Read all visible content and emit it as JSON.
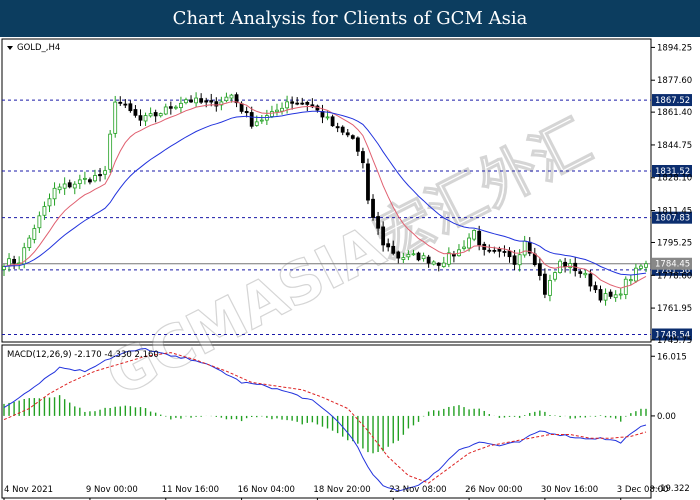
{
  "header": {
    "title": "Chart Analysis for Clients of GCM Asia"
  },
  "watermark": {
    "text": "GCMASIA宏汇外汇"
  },
  "chart_data": [
    {
      "type": "candlestick",
      "symbol_label": "GOLD_,H4",
      "ylim": [
        1745.75,
        1897.5
      ],
      "y_ticks": [
        "1894.25",
        "1877.60",
        "1861.40",
        "1844.75",
        "1828.10",
        "1811.45",
        "1795.25",
        "1778.60",
        "1761.95",
        "1745.75"
      ],
      "x_labels": [
        {
          "label": "4 Nov 2021",
          "index": 0
        },
        {
          "label": "9 Nov 00:00",
          "index": 17
        },
        {
          "label": "11 Nov 16:00",
          "index": 32
        },
        {
          "label": "16 Nov 04:00",
          "index": 47
        },
        {
          "label": "18 Nov 20:00",
          "index": 62
        },
        {
          "label": "23 Nov 08:00",
          "index": 77
        },
        {
          "label": "26 Nov 00:00",
          "index": 92
        },
        {
          "label": "30 Nov 16:00",
          "index": 107
        },
        {
          "label": "3 Dec 08:00",
          "index": 122
        }
      ],
      "levels": [
        {
          "label": "1867.52",
          "value": 1867.52
        },
        {
          "label": "1831.52",
          "value": 1831.52
        },
        {
          "label": "1807.83",
          "value": 1807.83
        },
        {
          "label": "1781.36",
          "value": 1781.36
        },
        {
          "label": "1748.54",
          "value": 1748.54
        }
      ],
      "current_price": {
        "label": "1784.45",
        "value": 1784.45
      },
      "ma_fast_color": "#e06070",
      "ma_slow_color": "#2233dd",
      "up_color": "#22a022",
      "down_color": "#000000",
      "close_anchors": [
        [
          0,
          1785
        ],
        [
          3,
          1786
        ],
        [
          6,
          1803
        ],
        [
          10,
          1822
        ],
        [
          16,
          1827
        ],
        [
          20,
          1830
        ],
        [
          22,
          1868
        ],
        [
          27,
          1857
        ],
        [
          30,
          1860
        ],
        [
          36,
          1868
        ],
        [
          41,
          1865
        ],
        [
          45,
          1870
        ],
        [
          49,
          1856
        ],
        [
          53,
          1860
        ],
        [
          56,
          1867
        ],
        [
          60,
          1866
        ],
        [
          63,
          1860
        ],
        [
          66,
          1852
        ],
        [
          69,
          1848
        ],
        [
          71,
          1835
        ],
        [
          72,
          1815
        ],
        [
          75,
          1795
        ],
        [
          78,
          1788
        ],
        [
          82,
          1788
        ],
        [
          86,
          1785
        ],
        [
          90,
          1791
        ],
        [
          93,
          1801
        ],
        [
          95,
          1790
        ],
        [
          99,
          1789
        ],
        [
          101,
          1785
        ],
        [
          103,
          1797
        ],
        [
          105,
          1786
        ],
        [
          107,
          1770
        ],
        [
          110,
          1785
        ],
        [
          113,
          1782
        ],
        [
          115,
          1778
        ],
        [
          118,
          1768
        ],
        [
          121,
          1767
        ],
        [
          123,
          1775
        ],
        [
          126,
          1783
        ],
        [
          127,
          1784.45
        ]
      ]
    },
    {
      "type": "macd",
      "label": "MACD(12,26,9) -2.170 -4.330 2.160",
      "ylim": [
        -21.5,
        18.5
      ],
      "y_ticks": [
        "16.015",
        "0.00",
        "-19.322"
      ],
      "series": [
        {
          "name": "MACD",
          "color": "#2233dd",
          "anchors": [
            [
              0,
              2
            ],
            [
              4,
              6
            ],
            [
              8,
              10
            ],
            [
              11,
              13
            ],
            [
              16,
              12
            ],
            [
              20,
              15
            ],
            [
              24,
              17
            ],
            [
              28,
              18
            ],
            [
              33,
              16
            ],
            [
              38,
              15
            ],
            [
              43,
              12
            ],
            [
              47,
              9
            ],
            [
              52,
              8
            ],
            [
              57,
              6
            ],
            [
              61,
              4
            ],
            [
              65,
              0
            ],
            [
              69,
              -6
            ],
            [
              72,
              -14
            ],
            [
              75,
              -19
            ],
            [
              78,
              -20
            ],
            [
              81,
              -19
            ],
            [
              84,
              -17
            ],
            [
              87,
              -13
            ],
            [
              90,
              -9
            ],
            [
              94,
              -7
            ],
            [
              98,
              -8
            ],
            [
              102,
              -7
            ],
            [
              106,
              -4
            ],
            [
              110,
              -5
            ],
            [
              114,
              -6
            ],
            [
              118,
              -6
            ],
            [
              122,
              -7
            ],
            [
              125,
              -4
            ],
            [
              127,
              -2.17
            ]
          ]
        },
        {
          "name": "Signal",
          "color": "#dd2222",
          "dashed": true,
          "anchors": [
            [
              0,
              -1
            ],
            [
              5,
              2
            ],
            [
              9,
              6
            ],
            [
              13,
              9
            ],
            [
              18,
              12
            ],
            [
              23,
              14
            ],
            [
              28,
              16
            ],
            [
              33,
              17
            ],
            [
              38,
              15
            ],
            [
              44,
              12
            ],
            [
              49,
              9
            ],
            [
              54,
              8
            ],
            [
              59,
              7
            ],
            [
              63,
              5
            ],
            [
              68,
              2
            ],
            [
              72,
              -4
            ],
            [
              76,
              -11
            ],
            [
              80,
              -16
            ],
            [
              84,
              -18
            ],
            [
              88,
              -14
            ],
            [
              92,
              -10
            ],
            [
              96,
              -8
            ],
            [
              100,
              -7
            ],
            [
              104,
              -6
            ],
            [
              108,
              -5
            ],
            [
              112,
              -5
            ],
            [
              116,
              -6
            ],
            [
              120,
              -6
            ],
            [
              124,
              -5.5
            ],
            [
              127,
              -4.33
            ]
          ]
        }
      ],
      "hist_color": "#22a022"
    }
  ]
}
